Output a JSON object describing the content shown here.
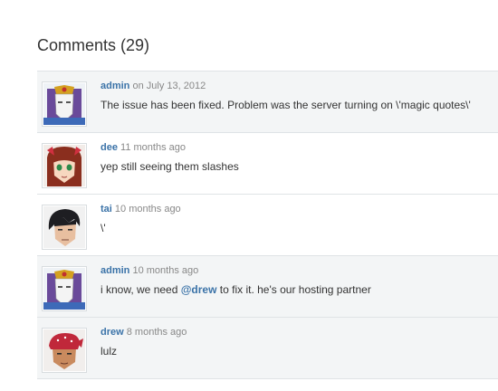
{
  "heading": "Comments (29)",
  "comments": [
    {
      "author": "admin",
      "time": "on July 13, 2012",
      "text": "The issue has been fixed. Problem was the server turning on \\'magic quotes\\'",
      "avatar_icon": "masked-admin-avatar-icon"
    },
    {
      "author": "dee",
      "time": "11 months ago",
      "text": "yep still seeing them slashes",
      "avatar_icon": "red-haired-girl-avatar-icon"
    },
    {
      "author": "tai",
      "time": "10 months ago",
      "text": "\\'",
      "avatar_icon": "dark-haired-man-avatar-icon"
    },
    {
      "author": "admin",
      "time": "10 months ago",
      "text_before": "i know, we need ",
      "mention": "@drew",
      "text_after": " to fix it. he's our hosting partner",
      "avatar_icon": "masked-admin-avatar-icon"
    },
    {
      "author": "drew",
      "time": "8 months ago",
      "text": "lulz",
      "avatar_icon": "bandana-man-avatar-icon"
    }
  ]
}
